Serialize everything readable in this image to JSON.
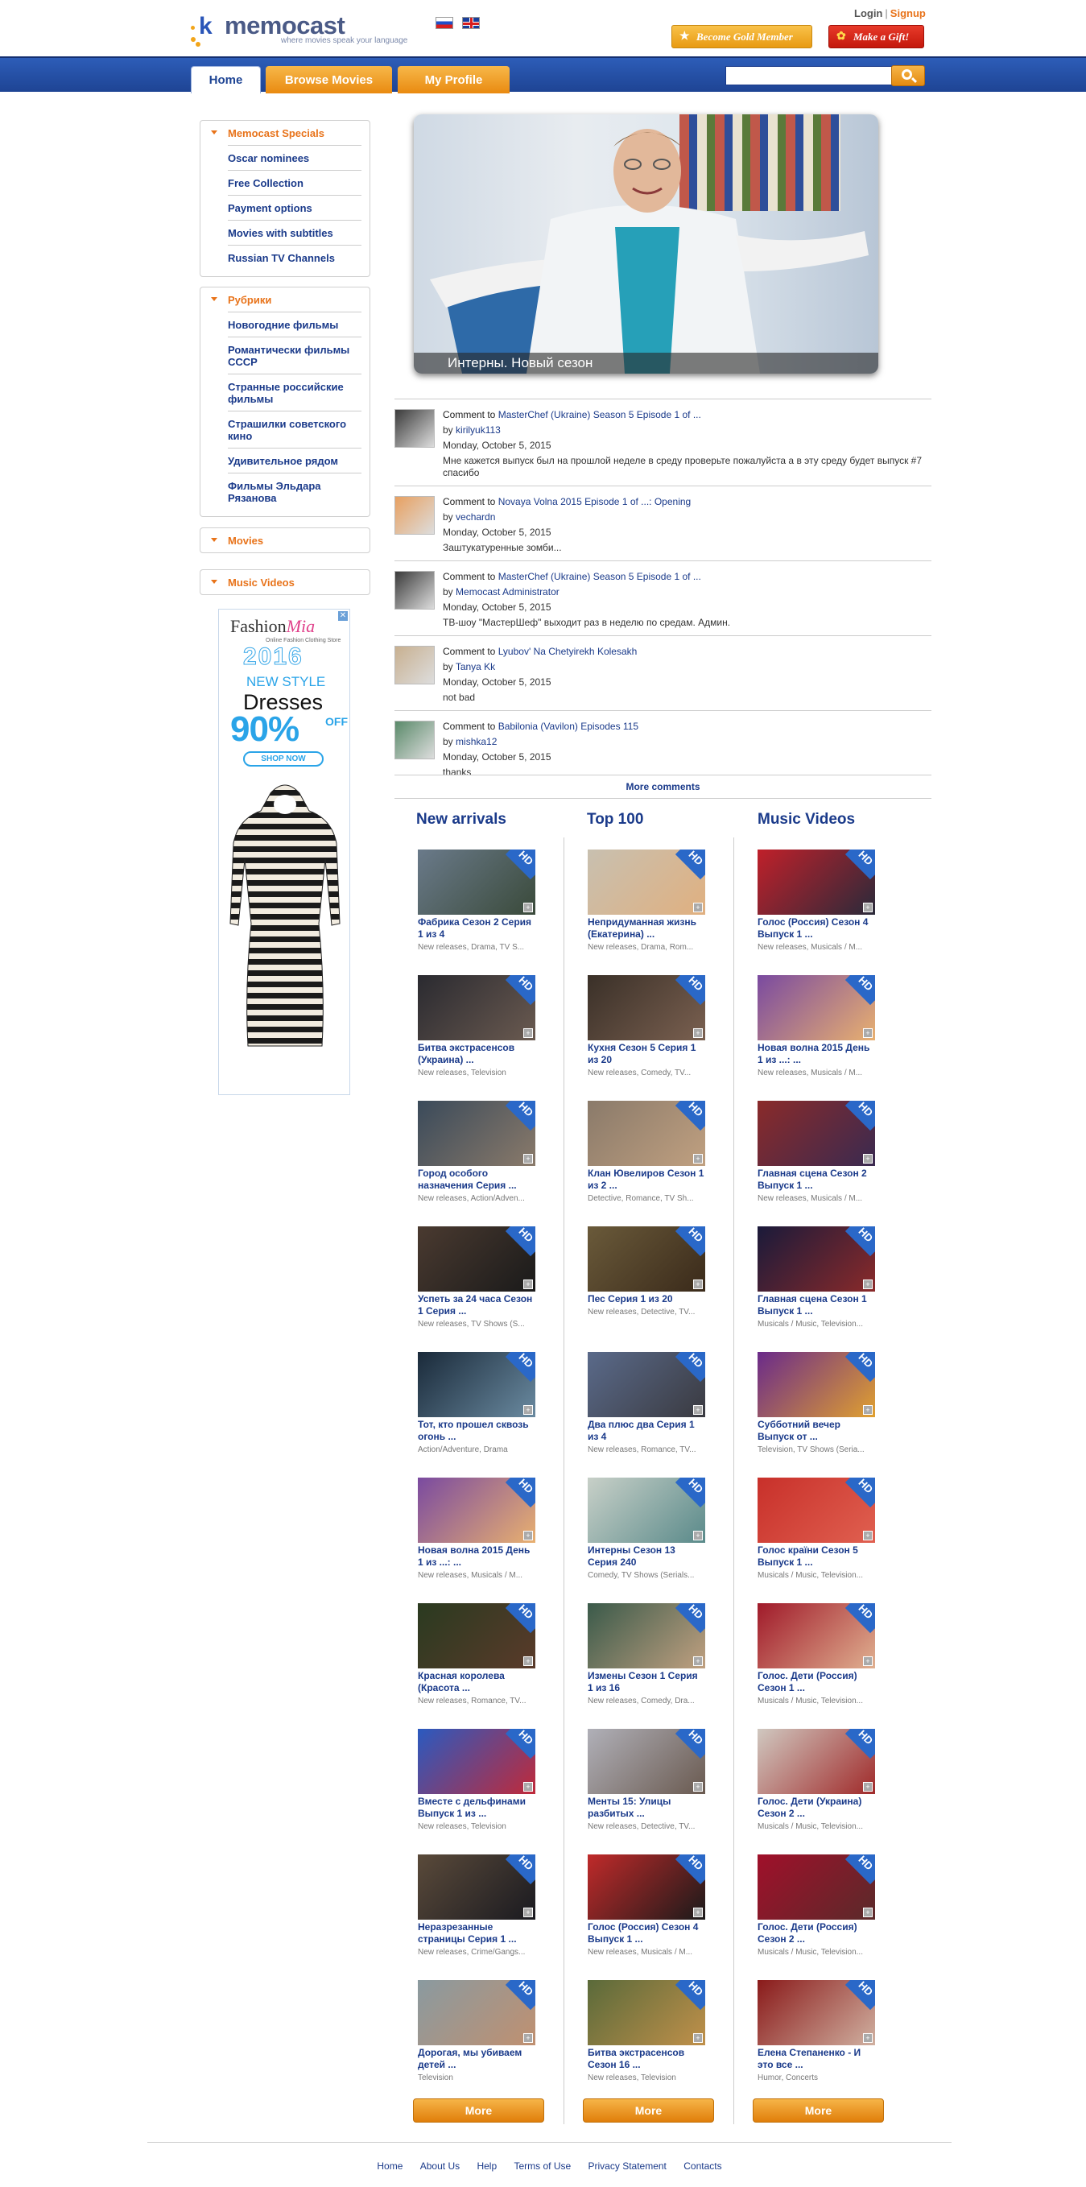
{
  "header": {
    "brand": "memocast",
    "tagline": "where movies speak your language",
    "login": "Login",
    "separator": "|",
    "signup": "Signup",
    "gold_button": "Become Gold Member",
    "gift_button": "Make a Gift!"
  },
  "nav": {
    "tabs": [
      "Home",
      "Browse Movies",
      "My Profile"
    ],
    "search_placeholder": ""
  },
  "sidebar": {
    "boxes": [
      {
        "title": "Memocast Specials",
        "items": [
          "Oscar nominees",
          "Free Collection",
          "Payment options",
          "Movies with subtitles",
          "Russian TV Channels"
        ]
      },
      {
        "title": "Рубрики",
        "items": [
          "Новогодние фильмы",
          "Романтически фильмы СССР",
          "Странные российские фильмы",
          "Страшилки советского кино",
          "Удивительное рядом",
          "Фильмы Эльдара Рязанова"
        ]
      },
      {
        "title": "Movies",
        "items": []
      },
      {
        "title": "Music Videos",
        "items": []
      }
    ]
  },
  "ad": {
    "brand_a": "Fashion",
    "brand_b": "Mia",
    "brand_sub": "Online Fashion Clothing Store",
    "year": "2016",
    "new_style": "NEW STYLE",
    "dresses": "Dresses",
    "percent": "90%",
    "off": "OFF",
    "shop_now": "SHOP NOW",
    "close": "✕"
  },
  "hero": {
    "caption": "Интерны. Новый сезон"
  },
  "comments": {
    "prefix": "Comment to",
    "by": "by",
    "items": [
      {
        "title": "MasterChef (Ukraine) Season 5 Episode 1 of ...",
        "user": "kirilyuk113",
        "date": "Monday, October 5, 2015",
        "text": "Мне кажется выпуск был на прошлой неделе в среду проверьте пожалуйста а в эту среду будет выпуск #7 спасибо",
        "avatar_color": "#3a3a3a"
      },
      {
        "title": "Novaya Volna 2015 Episode 1 of ...: Opening",
        "user": "vechardn",
        "date": "Monday, October 5, 2015",
        "text": "Заштукатуренные зомби...",
        "avatar_color": "#e8a060"
      },
      {
        "title": "MasterChef (Ukraine) Season 5 Episode 1 of ...",
        "user": "Memocast Administrator",
        "date": "Monday, October 5, 2015",
        "text": "ТВ-шоу \"МастерШеф\" выходит раз в неделю по средам. Админ.",
        "avatar_color": "#3a3a3a"
      },
      {
        "title": "Lyubov' Na Chetyirekh Kolesakh",
        "user": "Tanya Kk",
        "date": "Monday, October 5, 2015",
        "text": "not bad",
        "avatar_color": "#c8b090"
      },
      {
        "title": "Babilonia (Vavilon) Episodes 115",
        "user": "mishka12",
        "date": "Monday, October 5, 2015",
        "text": "thanks",
        "avatar_color": "#5a8a6a"
      }
    ],
    "more": "More comments"
  },
  "columns": [
    {
      "title": "New arrivals",
      "items": [
        {
          "title": "Фабрика Сезон 2 Серия 1 из 4",
          "genres": "New releases, Drama, TV S...",
          "c1": "#6a7a8a",
          "c2": "#3a4a3a"
        },
        {
          "title": "Битва экстрасенсов (Украина) ...",
          "genres": "New releases, Television",
          "c1": "#2a2a30",
          "c2": "#6a5a50"
        },
        {
          "title": "Город особого назначения Серия ...",
          "genres": "New releases, Action/Adven...",
          "c1": "#3a4a5a",
          "c2": "#8a7a6a"
        },
        {
          "title": "Успеть за 24 часа Сезон 1 Серия ...",
          "genres": "New releases, TV Shows (S...",
          "c1": "#4a3a30",
          "c2": "#1a1a1a"
        },
        {
          "title": "Тот, кто прошел сквозь огонь ...",
          "genres": "Action/Adventure, Drama",
          "c1": "#1a2a3a",
          "c2": "#6a8aa0"
        },
        {
          "title": "Новая волна 2015 День 1 из ...: ...",
          "genres": "New releases, Musicals / M...",
          "c1": "#7a4aa0",
          "c2": "#e8b070"
        },
        {
          "title": "Красная королева (Красота ...",
          "genres": "New releases, Romance, TV...",
          "c1": "#2a3a20",
          "c2": "#5a3a2a"
        },
        {
          "title": "Вместе с дельфинами Выпуск 1 из ...",
          "genres": "New releases, Television",
          "c1": "#2a5ac0",
          "c2": "#c02a3a"
        },
        {
          "title": "Неразрезанные страницы Серия 1 ...",
          "genres": "New releases, Crime/Gangs...",
          "c1": "#5a4a3a",
          "c2": "#1a1a20"
        },
        {
          "title": "Дорогая, мы убиваем детей ...",
          "genres": "Television",
          "c1": "#8a9aa0",
          "c2": "#c09070"
        }
      ]
    },
    {
      "title": "Top 100",
      "items": [
        {
          "title": "Непридуманная жизнь (Екатерина) ...",
          "genres": "New releases, Drama, Rom...",
          "c1": "#c8c0b0",
          "c2": "#e0b080"
        },
        {
          "title": "Кухня Сезон 5 Серия 1 из 20",
          "genres": "New releases, Comedy, TV...",
          "c1": "#3a3028",
          "c2": "#7a6050"
        },
        {
          "title": "Клан Ювелиров Сезон 1 из 2 ...",
          "genres": "Detective, Romance, TV Sh...",
          "c1": "#8a7a6a",
          "c2": "#c0a080"
        },
        {
          "title": "Пес Серия 1 из 20",
          "genres": "New releases, Detective, TV...",
          "c1": "#6a5a3a",
          "c2": "#3a2a1a"
        },
        {
          "title": "Два плюс два Серия 1 из 4",
          "genres": "New releases, Romance, TV...",
          "c1": "#5a6a8a",
          "c2": "#3a3a40"
        },
        {
          "title": "Интерны Сезон 13 Серия 240",
          "genres": "Comedy, TV Shows (Serials...",
          "c1": "#c8d0c8",
          "c2": "#5a8a8a"
        },
        {
          "title": "Измены Сезон 1 Серия 1 из 16",
          "genres": "New releases, Comedy, Dra...",
          "c1": "#3a5a4a",
          "c2": "#c0a080"
        },
        {
          "title": "Менты 15: Улицы разбитых ...",
          "genres": "New releases, Detective, TV...",
          "c1": "#b0b0b8",
          "c2": "#6a5a50"
        },
        {
          "title": "Голос (Россия) Сезон 4 Выпуск 1 ...",
          "genres": "New releases, Musicals / M...",
          "c1": "#c02a2a",
          "c2": "#1a1a1a"
        },
        {
          "title": "Битва экстрасенсов Сезон 16 ...",
          "genres": "New releases, Television",
          "c1": "#5a6a3a",
          "c2": "#c0904a"
        }
      ]
    },
    {
      "title": "Music Videos",
      "items": [
        {
          "title": "Голос (Россия) Сезон 4 Выпуск 1 ...",
          "genres": "New releases, Musicals / M...",
          "c1": "#c0202a",
          "c2": "#2a2a3a"
        },
        {
          "title": "Новая волна 2015 День 1 из ...: ...",
          "genres": "New releases, Musicals / M...",
          "c1": "#7a4aa0",
          "c2": "#e8b070"
        },
        {
          "title": "Главная сцена Сезон 2 Выпуск 1 ...",
          "genres": "New releases, Musicals / M...",
          "c1": "#8a2a2a",
          "c2": "#3a2a50"
        },
        {
          "title": "Главная сцена Сезон 1 Выпуск 1 ...",
          "genres": "Musicals / Music, Television...",
          "c1": "#1a1a3a",
          "c2": "#8a2a2a"
        },
        {
          "title": "Субботний вечер Выпуск от ...",
          "genres": "Television, TV Shows (Seria...",
          "c1": "#6a2a8a",
          "c2": "#e0a030"
        },
        {
          "title": "Голос краïни Сезон 5 Выпуск 1 ...",
          "genres": "Musicals / Music, Television...",
          "c1": "#c8302a",
          "c2": "#e06050"
        },
        {
          "title": "Голос. Дети (Россия) Сезон 1 ...",
          "genres": "Musicals / Music, Television...",
          "c1": "#a01a2a",
          "c2": "#e0b090"
        },
        {
          "title": "Голос. Дети (Украина) Сезон 2 ...",
          "genres": "Musicals / Music, Television...",
          "c1": "#d0c8c0",
          "c2": "#a02a2a"
        },
        {
          "title": "Голос. Дети (Россия) Сезон 2 ...",
          "genres": "Musicals / Music, Television...",
          "c1": "#a0102a",
          "c2": "#5a2a2a"
        },
        {
          "title": "Елена Степаненко - И это все ...",
          "genres": "Humor, Concerts",
          "c1": "#8a1a1a",
          "c2": "#d0b0a0"
        }
      ]
    }
  ],
  "hd_label": "HD",
  "more_button": "More",
  "footer": {
    "links": [
      "Home",
      "About Us",
      "Help",
      "Terms of Use",
      "Privacy Statement",
      "Contacts"
    ]
  }
}
